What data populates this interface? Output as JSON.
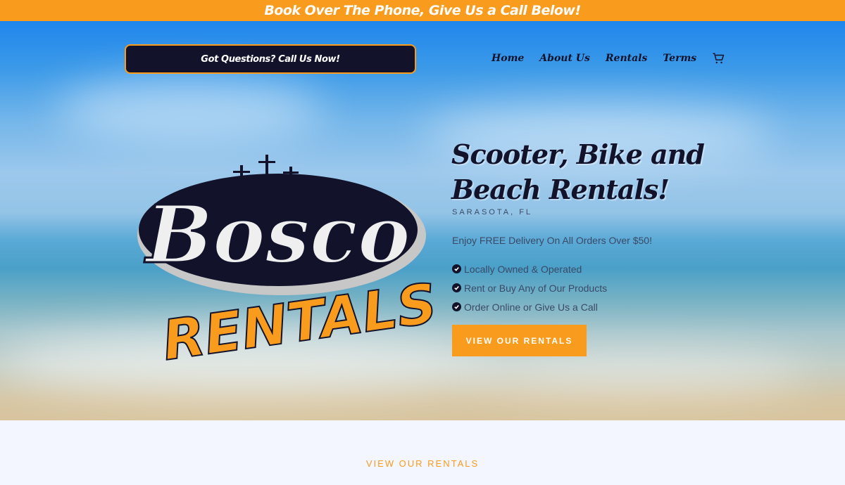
{
  "announcement": {
    "text": "Book Over The Phone, Give Us a Call Below!"
  },
  "header": {
    "cta_label": "Got Questions? Call Us Now!",
    "nav": [
      {
        "label": "Home"
      },
      {
        "label": "About Us"
      },
      {
        "label": "Rentals"
      },
      {
        "label": "Terms"
      }
    ],
    "cart_icon": "cart-icon"
  },
  "logo": {
    "word1": "Bosco",
    "word2": "RENTALS"
  },
  "hero": {
    "headline_line1": "Scooter, Bike and",
    "headline_line2": "Beach Rentals!",
    "location": "SARASOTA, FL",
    "delivery": "Enjoy FREE Delivery On All Orders Over $50!",
    "features": [
      "Locally Owned & Operated",
      "Rent or Buy Any of Our Products",
      "Order Online or Give Us a Call"
    ],
    "button_label": "VIEW OUR RENTALS"
  },
  "section": {
    "label": "VIEW OUR RENTALS"
  },
  "colors": {
    "accent": "#f99b1c",
    "navy": "#12132b",
    "page_bg": "#f4f6ff"
  }
}
